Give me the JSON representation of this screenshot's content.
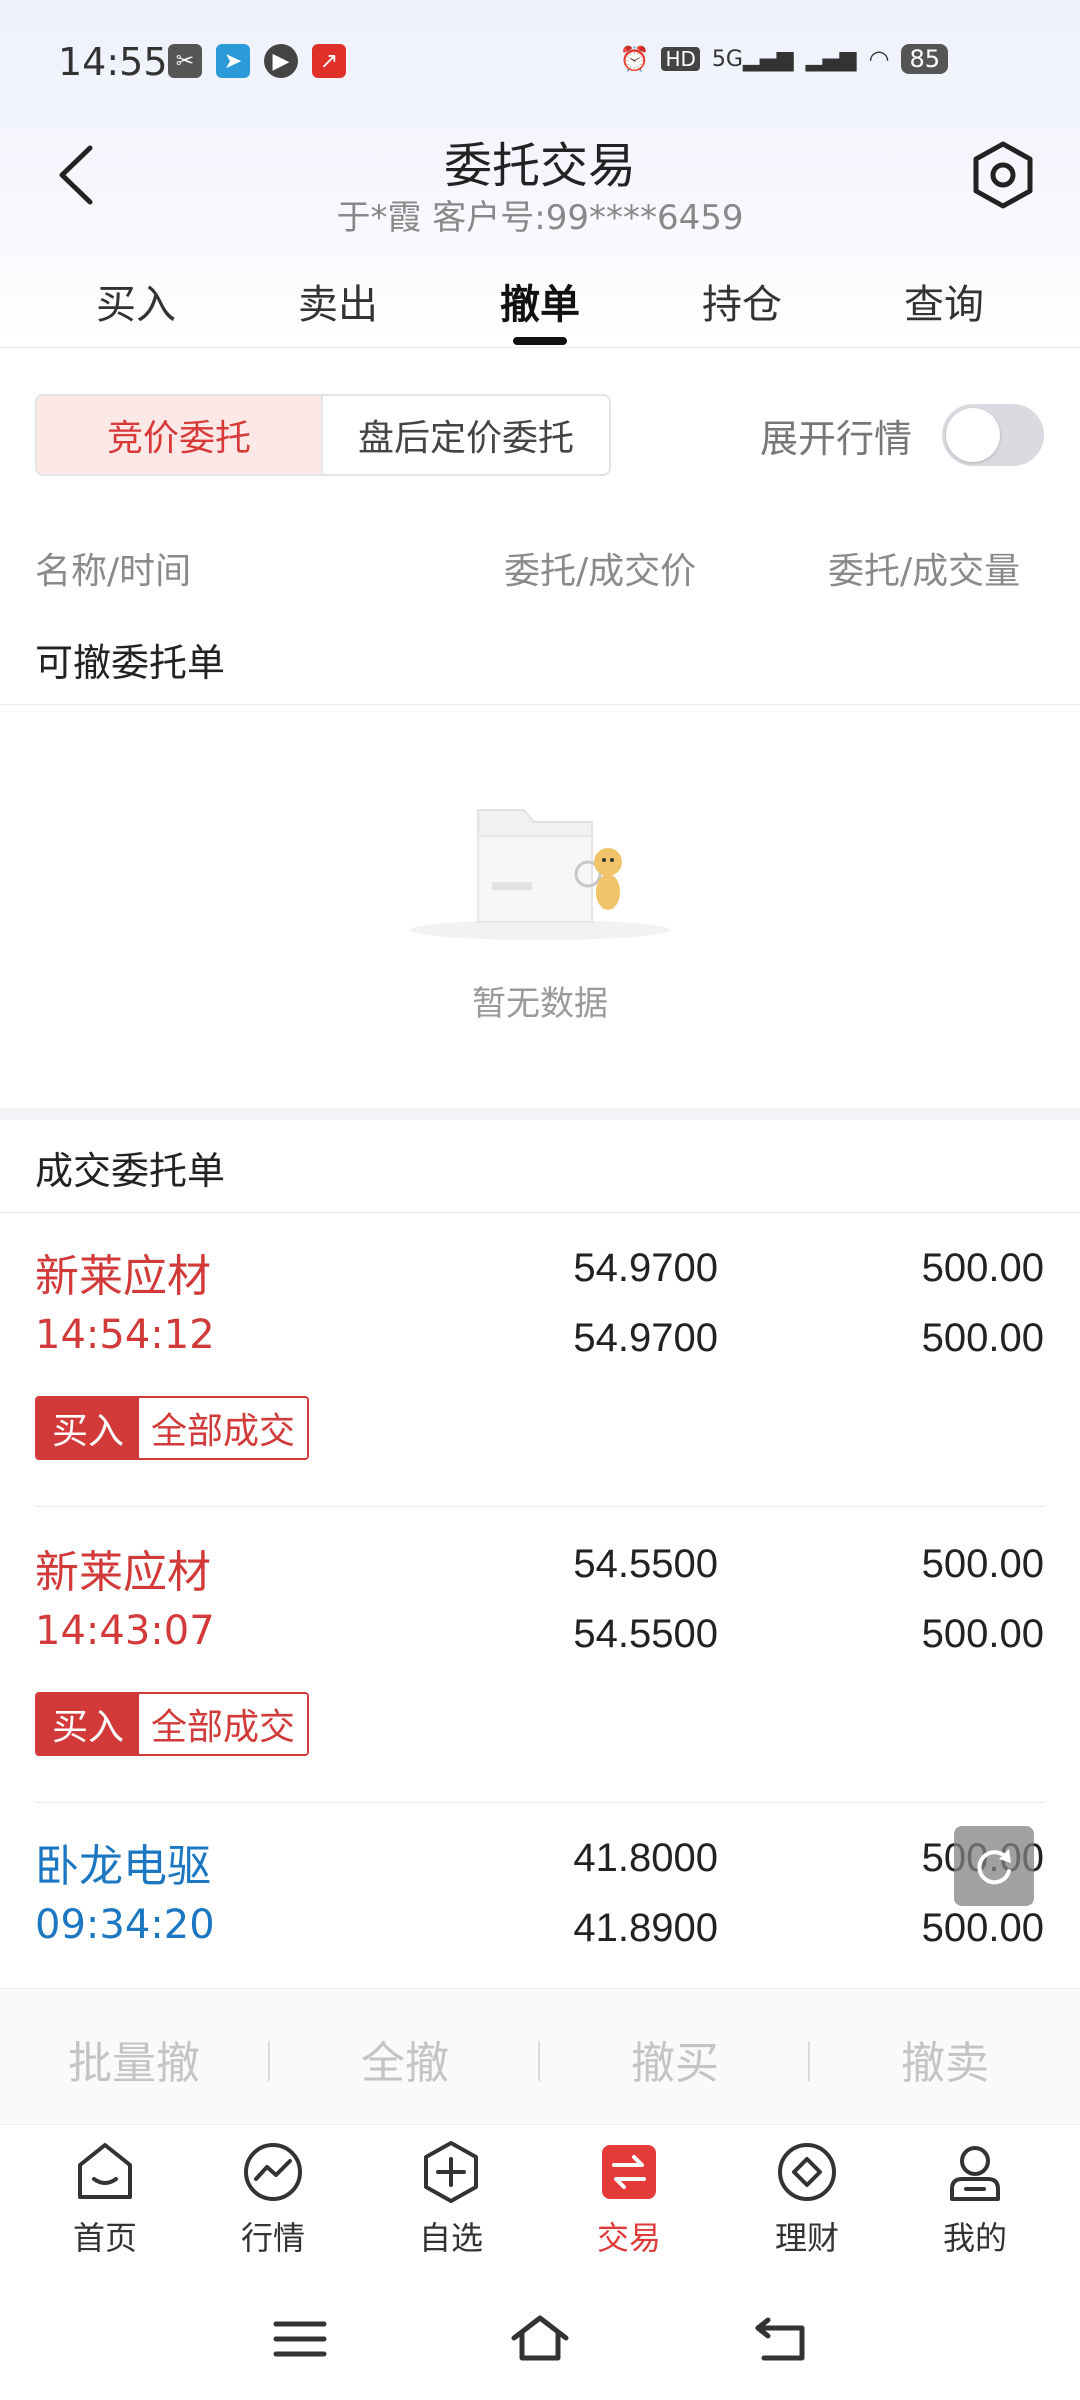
{
  "status_bar": {
    "time": "14:55",
    "network": "5G",
    "battery": "85"
  },
  "header": {
    "title": "委托交易",
    "subtitle": "于*霞 客户号:99****6459"
  },
  "tabs": [
    {
      "label": "买入"
    },
    {
      "label": "卖出"
    },
    {
      "label": "撤单"
    },
    {
      "label": "持仓"
    },
    {
      "label": "查询"
    }
  ],
  "segment": {
    "active": "竞价委托",
    "inactive": "盘后定价委托"
  },
  "expand_quotes": {
    "label": "展开行情",
    "enabled": false
  },
  "columns": {
    "name_time": "名称/时间",
    "price": "委托/成交价",
    "qty": "委托/成交量"
  },
  "cancellable": {
    "title": "可撤委托单",
    "empty_text": "暂无数据"
  },
  "filled": {
    "title": "成交委托单",
    "records": [
      {
        "name": "新莱应材",
        "time": "14:54:12",
        "order_price": "54.9700",
        "fill_price": "54.9700",
        "order_qty": "500.00",
        "fill_qty": "500.00",
        "side": "买入",
        "status": "全部成交"
      },
      {
        "name": "新莱应材",
        "time": "14:43:07",
        "order_price": "54.5500",
        "fill_price": "54.5500",
        "order_qty": "500.00",
        "fill_qty": "500.00",
        "side": "买入",
        "status": "全部成交"
      },
      {
        "name": "卧龙电驱",
        "time": "09:34:20",
        "order_price": "41.8000",
        "fill_price": "41.8900",
        "order_qty": "500.00",
        "fill_qty": "500.00"
      }
    ]
  },
  "actions": {
    "batch_cancel": "批量撤",
    "cancel_all": "全撤",
    "cancel_buy": "撤买",
    "cancel_sell": "撤卖"
  },
  "bottom_nav": [
    {
      "label": "首页",
      "icon": "home-icon"
    },
    {
      "label": "行情",
      "icon": "market-icon"
    },
    {
      "label": "自选",
      "icon": "watchlist-icon"
    },
    {
      "label": "交易",
      "icon": "trade-icon"
    },
    {
      "label": "理财",
      "icon": "wealth-icon"
    },
    {
      "label": "我的",
      "icon": "profile-icon"
    }
  ],
  "colors": {
    "accent_red": "#d23a3a",
    "sell_blue": "#1c77c3"
  }
}
